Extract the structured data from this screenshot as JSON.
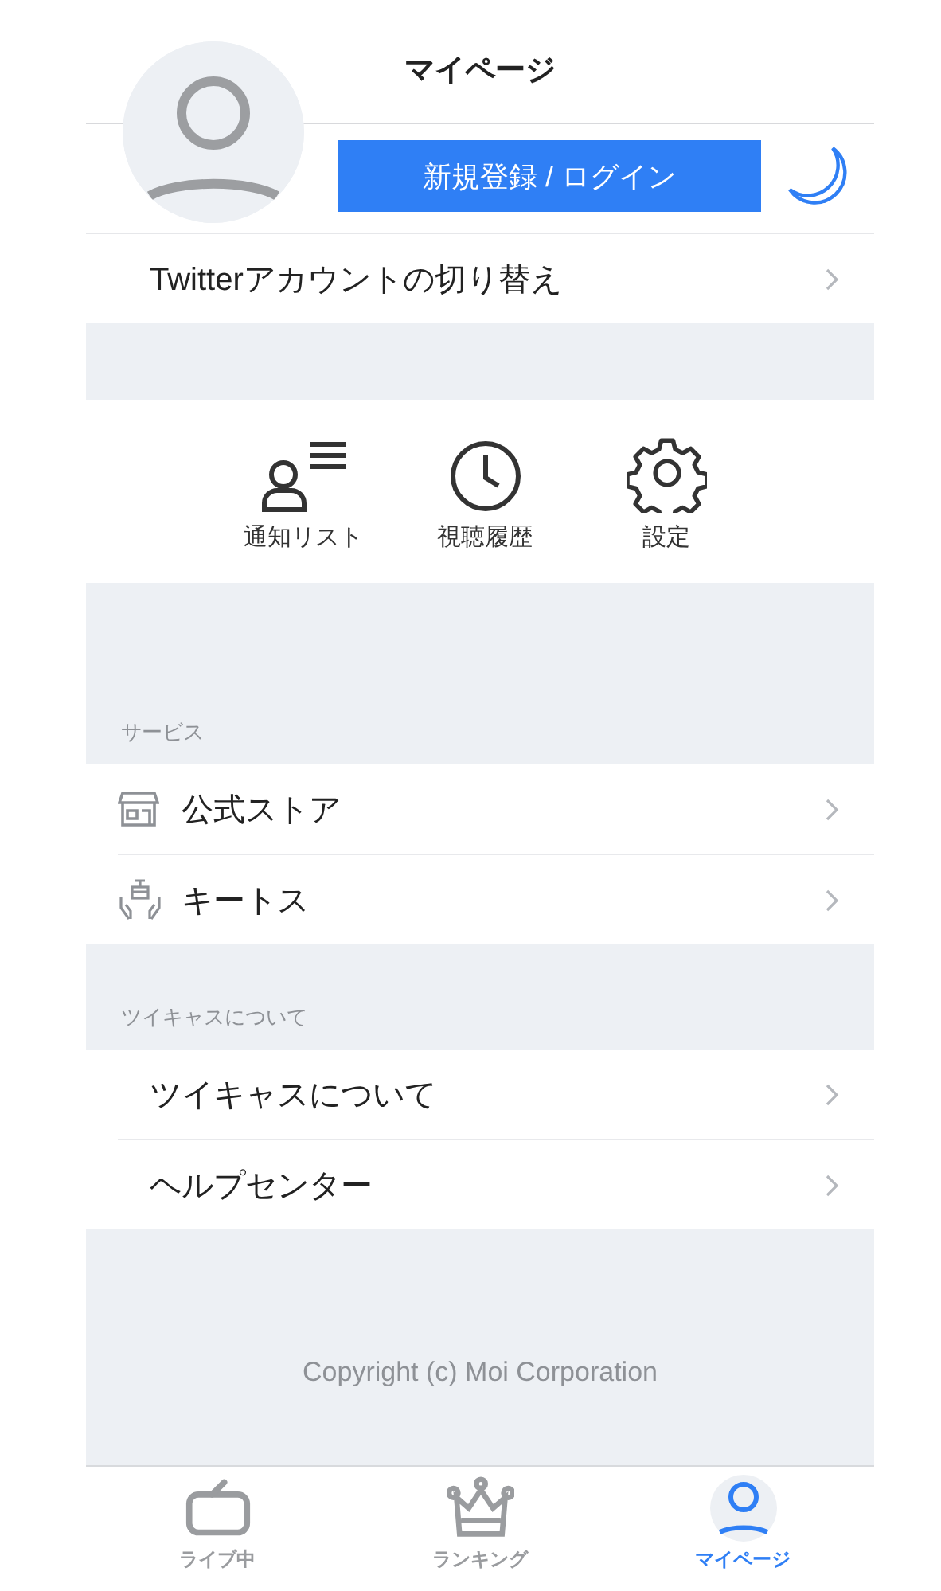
{
  "header": {
    "title": "マイページ",
    "login_button": "新規登録 / ログイン"
  },
  "twitter_row": {
    "label": "Twitterアカウントの切り替え"
  },
  "shortcuts": [
    {
      "label": "通知リスト",
      "kind": "notify"
    },
    {
      "label": "視聴履歴",
      "kind": "history"
    },
    {
      "label": "設定",
      "kind": "settings"
    }
  ],
  "sections": [
    {
      "title": "サービス",
      "items": [
        {
          "label": "公式ストア",
          "kind": "store"
        },
        {
          "label": "キートス",
          "kind": "gift"
        }
      ]
    },
    {
      "title": "ツイキャスについて",
      "items": [
        {
          "label": "ツイキャスについて",
          "kind": "text"
        },
        {
          "label": "ヘルプセンター",
          "kind": "text"
        }
      ]
    }
  ],
  "copyright": "Copyright (c) Moi Corporation",
  "tab_bar": [
    {
      "label": "ライブ中",
      "kind": "tv",
      "selected": false
    },
    {
      "label": "ランキング",
      "kind": "crown",
      "selected": false
    },
    {
      "label": "マイページ",
      "kind": "person",
      "selected": true
    }
  ]
}
